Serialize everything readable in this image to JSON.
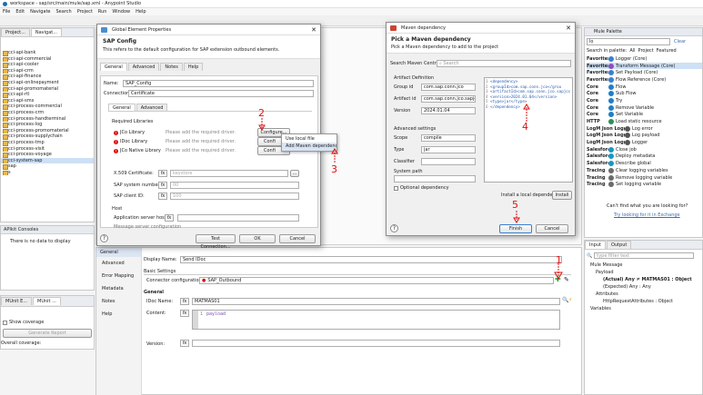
{
  "window": {
    "title": "workspace - sap/src/main/mule/sap.xml - Anypoint Studio"
  },
  "menu": [
    "File",
    "Edit",
    "Navigate",
    "Search",
    "Project",
    "Run",
    "Window",
    "Help"
  ],
  "left": {
    "tabs": [
      "Project...",
      "Navigat..."
    ],
    "tree": [
      "cci-api-bank",
      "cci-api-commercial",
      "cci-api-cooler",
      "cci-api-crm",
      "cci-api-finance",
      "cci-api-onlinepayment",
      "cci-api-promomaterial",
      "cci-api-rtl",
      "cci-api-sms",
      "cci-process-commercial",
      "cci-process-crm",
      "cci-process-handterminal",
      "cci-process-log",
      "cci-process-promomaterial",
      "cci-process-supplychain",
      "cci-process-tmp",
      "cci-process-visit",
      "cci-process-voyage",
      "cci-system-sap",
      "sap",
      "s"
    ],
    "apikit": {
      "title": "APIkit Consoles",
      "text": "There is no data to display"
    },
    "bottom_tabs": [
      "MUnit E...",
      "MUnit ..."
    ],
    "show_coverage": "Show coverage",
    "generate_report": "Generate Report",
    "overall": "Overall coverage:"
  },
  "gep": {
    "title": "Global Element Properties",
    "heading": "SAP Config",
    "desc": "This refers to the default configuration for SAP extension outbound elements.",
    "tabs": [
      "General",
      "Advanced",
      "Notes",
      "Help"
    ],
    "name_label": "Name:",
    "name_value": "SAP_Config",
    "conn_label": "Connection:",
    "conn_value": "Certificate",
    "inner_tabs": [
      "General",
      "Advanced"
    ],
    "req_libs": "Required Libraries",
    "libs": [
      {
        "name": "JCo Library",
        "msg": "Please add the required driver.",
        "btn": "Configure..."
      },
      {
        "name": "IDoc Library",
        "msg": "Please add the required driver.",
        "btn": "Confi"
      },
      {
        "name": "JCo Native Library",
        "msg": "Please add the required driver.",
        "btn": "Confi"
      }
    ],
    "dropdown": [
      "Use local file",
      "Add Maven dependency"
    ],
    "x509_label": "X.509 Certificate:",
    "x509_placeholder": "keystore",
    "sysnum_label": "SAP system number:",
    "sysnum_value": "00",
    "client_label": "SAP client ID:",
    "client_value": "100",
    "host_section": "Host",
    "apphost_label": "Application server host:",
    "msgserver_label": "Message server configuration",
    "test_btn": "Test Connection...",
    "ok_btn": "OK",
    "cancel_btn": "Cancel"
  },
  "maven": {
    "title": "Maven dependency",
    "heading": "Pick a Maven dependency",
    "desc": "Pick a Maven dependency to add to the project",
    "search_label": "Search Maven Central",
    "search_placeholder": "Search",
    "artifact_section": "Artifact Definition",
    "group_label": "Group id",
    "group_value": "com.sap.conn.jco",
    "artifact_label": "Artifact id",
    "artifact_value": "com.sap.conn.jco.sapjco3",
    "version_label": "Version",
    "version_value": "2024.01.04",
    "advanced_section": "Advanced settings",
    "scope_label": "Scope",
    "scope_value": "compile",
    "type_label": "Type",
    "type_value": "jar",
    "classifier_label": "Classifier",
    "syspath_label": "System path",
    "optional_label": "Optional dependency",
    "xml": [
      "<dependency>",
      "  <groupId>com.sap.conn.jco</grou",
      "  <artifactId>com.sap.conn.jco.sapjcc",
      "  <version>2024.01.04</version>",
      "  <type>jar</type>",
      "</dependency>"
    ],
    "install_text": "Install a local dependency",
    "install_btn": "Install",
    "finish_btn": "Finish",
    "cancel_btn": "Cancel"
  },
  "palette": {
    "title": "Mule Palette",
    "search_value": "lo",
    "clear": "Clear",
    "tabs": [
      "Search in palette:",
      "All",
      "Project",
      "Featured"
    ],
    "items": [
      {
        "cat": "Favorites",
        "name": "Logger (Core)",
        "color": "#3a7fd1"
      },
      {
        "cat": "Favorites",
        "name": "Transform Message (Core)",
        "color": "#8a4fc1",
        "selected": true
      },
      {
        "cat": "Favorites",
        "name": "Set Payload (Core)",
        "color": "#3a7fd1"
      },
      {
        "cat": "Favorites",
        "name": "Flow Reference (Core)",
        "color": "#3a7fd1"
      },
      {
        "cat": "Core",
        "name": "Flow",
        "color": "#1f7fc9"
      },
      {
        "cat": "Core",
        "name": "Sub Flow",
        "color": "#1f7fc9"
      },
      {
        "cat": "Core",
        "name": "Try",
        "color": "#1f7fc9"
      },
      {
        "cat": "Core",
        "name": "Remove Variable",
        "color": "#1f7fc9"
      },
      {
        "cat": "Core",
        "name": "Set Variable",
        "color": "#1f7fc9"
      },
      {
        "cat": "HTTP",
        "name": "Load static resource",
        "color": "#2d8f5a"
      },
      {
        "cat": "LogM Json Logger",
        "name": "Log error",
        "color": "#555555"
      },
      {
        "cat": "LogM Json Logger",
        "name": "Log payload",
        "color": "#555555"
      },
      {
        "cat": "LogM Json Logger",
        "name": "Logger",
        "color": "#555555"
      },
      {
        "cat": "Salesforce",
        "name": "Close job",
        "color": "#1798c1"
      },
      {
        "cat": "Salesforce",
        "name": "Deploy metadata",
        "color": "#1798c1"
      },
      {
        "cat": "Salesforce",
        "name": "Describe global",
        "color": "#1798c1"
      },
      {
        "cat": "Tracing",
        "name": "Clear logging variables",
        "color": "#6b6b6b"
      },
      {
        "cat": "Tracing",
        "name": "Remove logging variable",
        "color": "#6b6b6b"
      },
      {
        "cat": "Tracing",
        "name": "Set logging variable",
        "color": "#6b6b6b"
      }
    ],
    "help": "Can't find what you are looking for?",
    "link": "Try looking for it in Exchange"
  },
  "props": {
    "left_tabs": [
      "General",
      "Advanced",
      "Error Mapping",
      "Metadata",
      "Notes",
      "Help"
    ],
    "display_label": "Display Name:",
    "display_value": "Send IDoc",
    "basic_settings": "Basic Settings",
    "connector_label": "Connector configuration:",
    "connector_value": "SAP_Outbound",
    "general": "General",
    "idoc_label": "IDoc Name:",
    "idoc_value": "MATMAS01",
    "content_label": "Content:",
    "content_value": "payload",
    "version_label": "Version:"
  },
  "metadata": {
    "tabs": [
      "Input",
      "Output"
    ],
    "filter_placeholder": "type filter text",
    "tree": [
      "Mule Message",
      "Payload",
      "(Actual) Any ≠ MATMAS01 : Object",
      "(Expected) Any : Any",
      "Attributes",
      "HttpRequestAttributes : Object",
      "Variables"
    ]
  },
  "annotations": [
    "1",
    "2",
    "3",
    "4",
    "5"
  ]
}
